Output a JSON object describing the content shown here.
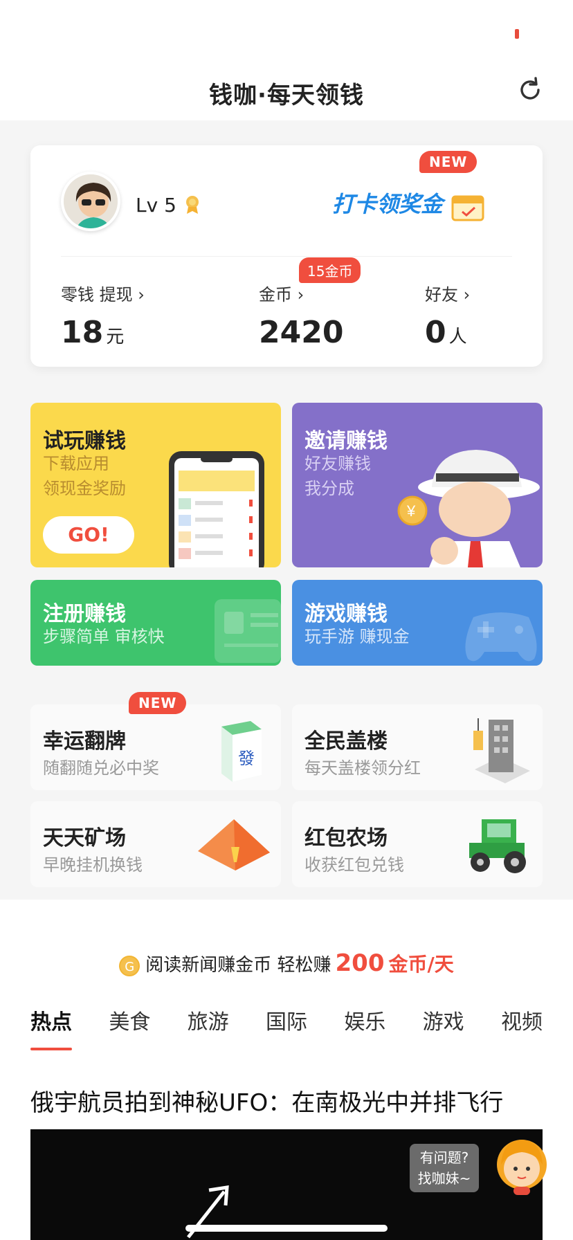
{
  "header": {
    "title": "钱咖·每天领钱"
  },
  "profile": {
    "level": "Lv 5",
    "checkin_label": "打卡领奖金",
    "new_badge": "NEW",
    "stats": [
      {
        "label": "零钱  提现 ›",
        "value": "18",
        "unit": "元"
      },
      {
        "label": "金币 ›",
        "value": "2420",
        "unit": ""
      },
      {
        "label": "好友 ›",
        "value": "0",
        "unit": "人"
      }
    ],
    "coin_tag": "15金币"
  },
  "tiles": {
    "trial": {
      "title": "试玩赚钱",
      "sub1": "下载应用",
      "sub2": "领现金奖励",
      "button": "GO!",
      "color": "#fbd94c"
    },
    "invite": {
      "title": "邀请赚钱",
      "sub1": "好友赚钱",
      "sub2": "我分成",
      "color": "#8470c9"
    },
    "register": {
      "title": "注册赚钱",
      "sub": "步骤简单 审核快",
      "color": "#3ec46d"
    },
    "game": {
      "title": "游戏赚钱",
      "sub": "玩手游 赚现金",
      "color": "#4a90e2"
    }
  },
  "features": [
    {
      "title": "幸运翻牌",
      "sub": "随翻随兑必中奖",
      "badge": "NEW",
      "icon": "mahjong-icon"
    },
    {
      "title": "全民盖楼",
      "sub": "每天盖楼领分红",
      "icon": "building-icon"
    },
    {
      "title": "天天矿场",
      "sub": "早晚挂机换钱",
      "icon": "pyramid-icon"
    },
    {
      "title": "红包农场",
      "sub": "收获红包兑钱",
      "icon": "tractor-icon"
    }
  ],
  "news": {
    "promo_text": "阅读新闻赚金币 轻松赚",
    "promo_num": "200",
    "promo_unit": "金币/天",
    "tabs": [
      "热点",
      "美食",
      "旅游",
      "国际",
      "娱乐",
      "游戏",
      "视频"
    ],
    "headline": "俄宇航员拍到神秘UFO：在南极光中并排飞行",
    "help_line1": "有问题?",
    "help_line2": "找咖妹~"
  }
}
